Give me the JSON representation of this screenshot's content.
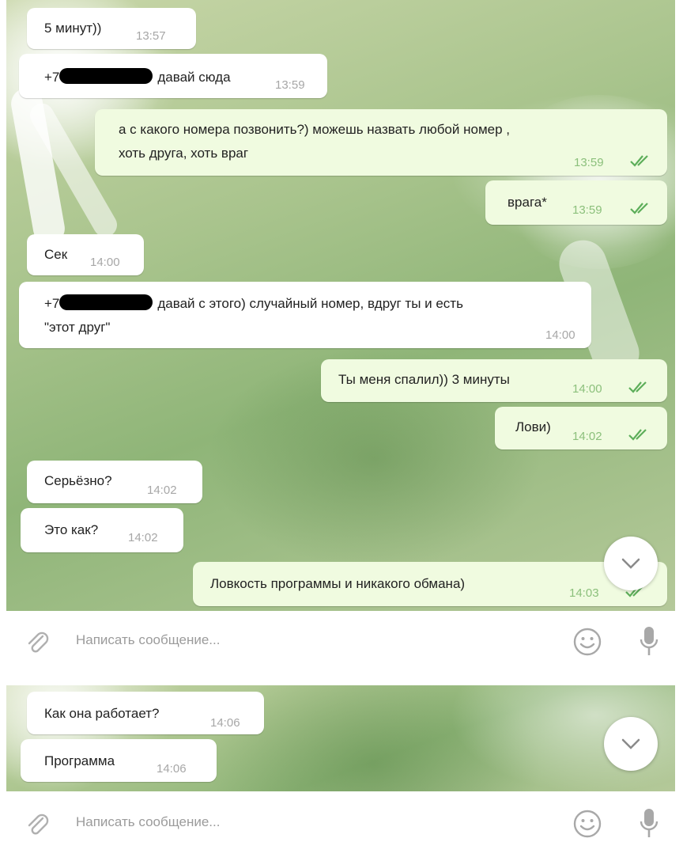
{
  "chat_1": {
    "messages": [
      {
        "dir": "in",
        "text": "5 минут))",
        "time": "13:57"
      },
      {
        "dir": "in",
        "prefix": "+7",
        "suffix": "давай сюда",
        "time": "13:59"
      },
      {
        "dir": "out",
        "line1": "а с какого номера позвонить?) можешь назвать любой номер ,",
        "line2": "хоть друга, хоть враг",
        "time": "13:59"
      },
      {
        "dir": "out",
        "text": "врага*",
        "time": "13:59"
      },
      {
        "dir": "in",
        "text": "Сек",
        "time": "14:00"
      },
      {
        "dir": "in",
        "prefix": "+7",
        "suffix": "давай с этого) случайный номер, вдруг ты и есть",
        "line2": "\"этот друг\"",
        "time": "14:00"
      },
      {
        "dir": "out",
        "text": "Ты меня спалил)) 3 минуты",
        "time": "14:00"
      },
      {
        "dir": "out",
        "text": "Лови)",
        "time": "14:02"
      },
      {
        "dir": "in",
        "text": "Серьёзно?",
        "time": "14:02"
      },
      {
        "dir": "in",
        "text": "Это как?",
        "time": "14:02"
      },
      {
        "dir": "out",
        "text": "Ловкость программы и никакого обмана)",
        "time": "14:03"
      }
    ],
    "input_placeholder": "Написать сообщение..."
  },
  "chat_2": {
    "messages": [
      {
        "dir": "in",
        "text": "Как она работает?",
        "time": "14:06"
      },
      {
        "dir": "in",
        "text": "Программа",
        "time": "14:06"
      }
    ],
    "input_placeholder": "Написать сообщение..."
  },
  "icons": {
    "attach": "paperclip-icon",
    "emoji": "smiley-icon",
    "mic": "microphone-icon",
    "scroll": "chevron-down-icon",
    "read": "double-check-icon"
  },
  "colors": {
    "incoming_bubble": "#ffffff",
    "outgoing_bubble": "#f0fbe0",
    "outgoing_time": "#8cc07c",
    "check": "#5dae5a"
  }
}
